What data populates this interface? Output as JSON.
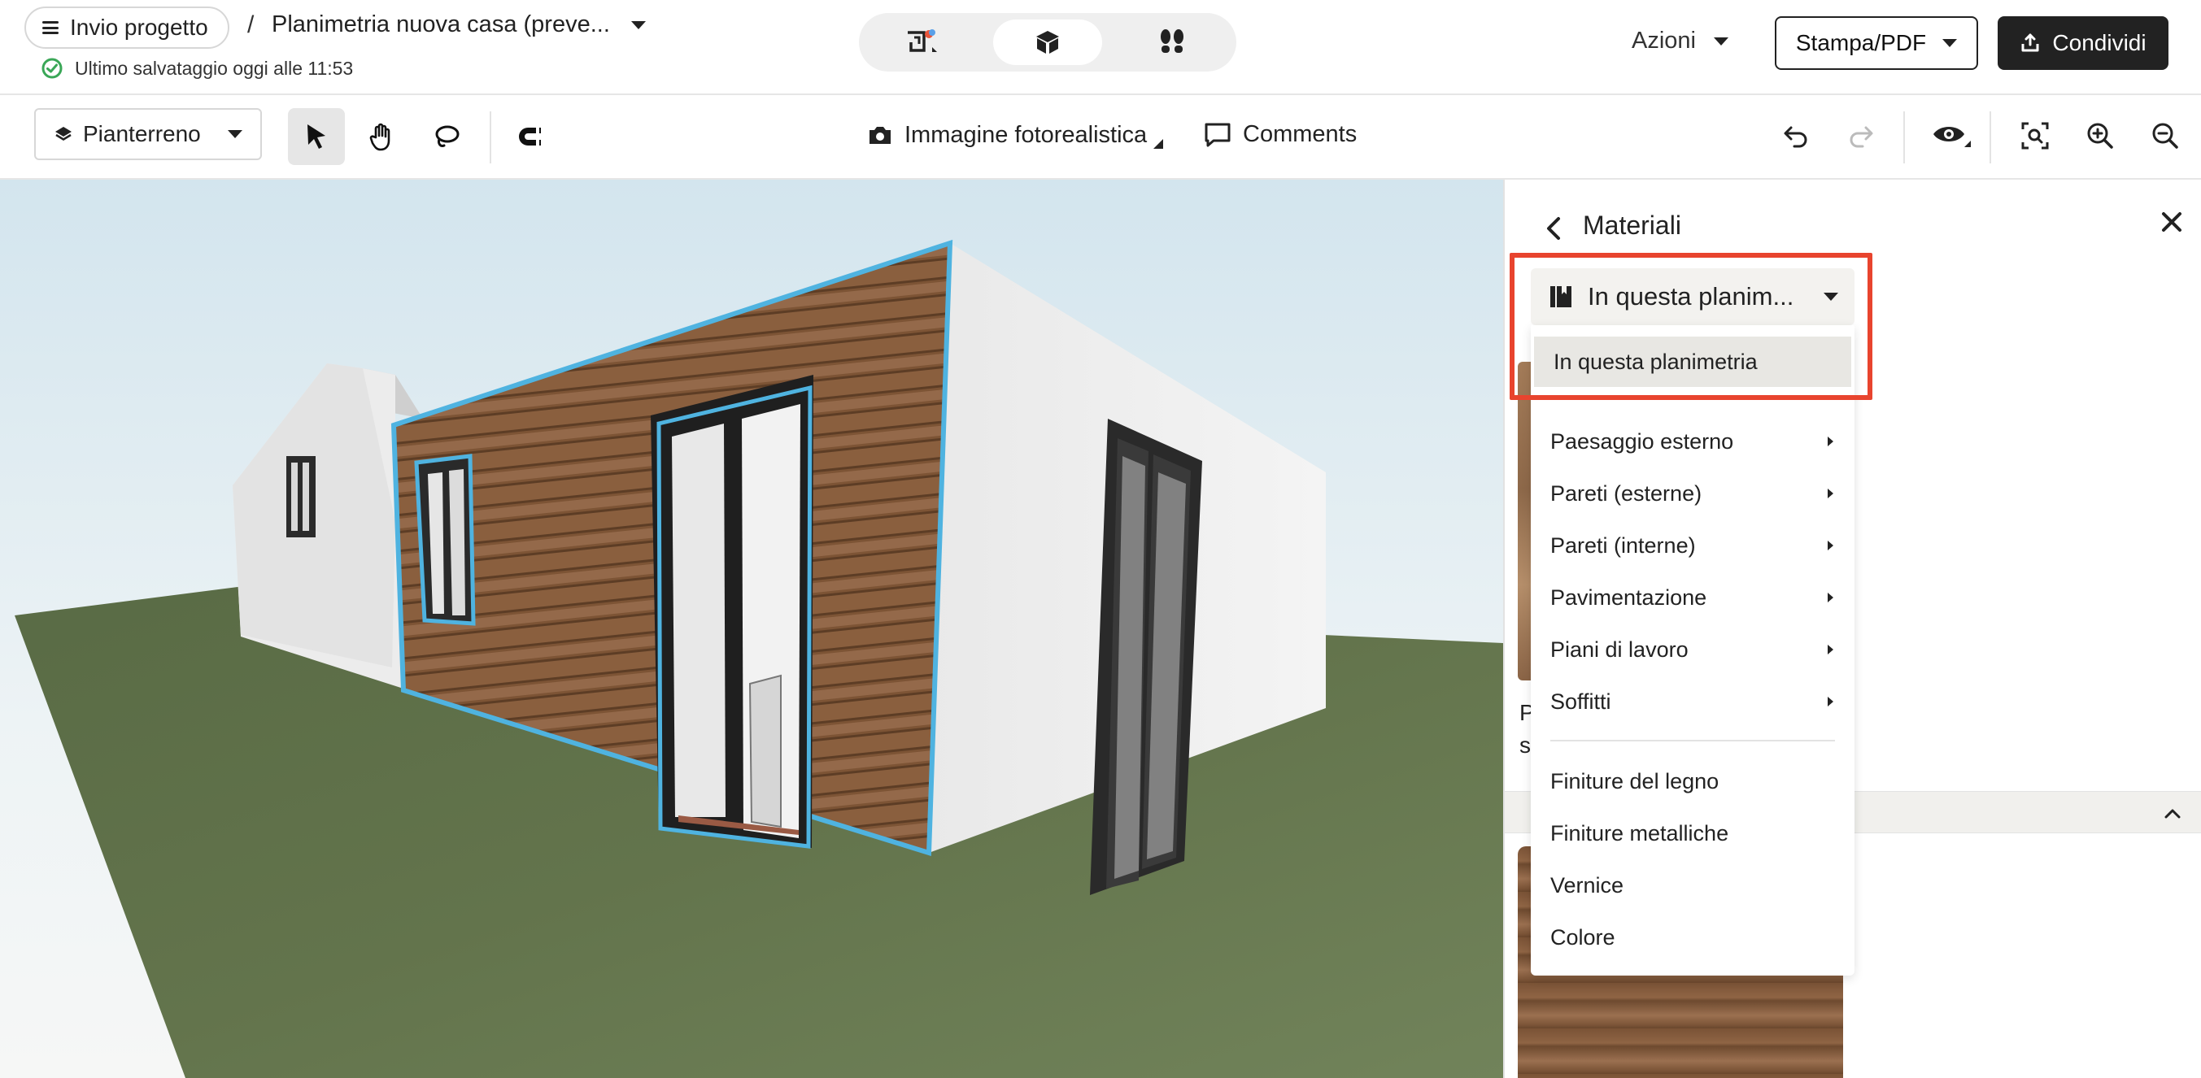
{
  "header": {
    "project_button": "Invio progetto",
    "breadcrumb_sep": "/",
    "plan_title": "Planimetria nuova casa (preve...",
    "saved_status": "Ultimo salvataggio oggi alle 11:53",
    "actions_label": "Azioni",
    "print_label": "Stampa/PDF",
    "share_label": "Condividi"
  },
  "toolbar": {
    "floor_label": "Pianterreno",
    "photo_label": "Immagine fotorealistica",
    "comments_label": "Comments"
  },
  "panel": {
    "title": "Materiali",
    "partial_text_1": "P",
    "partial_text_2": "st"
  },
  "dropdown": {
    "selected_value": "In questa planim...",
    "items": [
      "In questa planimetria",
      "Paesaggio esterno",
      "Pareti (esterne)",
      "Pareti (interne)",
      "Pavimentazione",
      "Piani di lavoro",
      "Soffitti",
      "Finiture del legno",
      "Finiture metalliche",
      "Vernice",
      "Colore"
    ]
  },
  "colors": {
    "accent_highlight": "#e8442e",
    "wall_outline": "#4fb3e0",
    "saved_check": "#3aa757"
  }
}
